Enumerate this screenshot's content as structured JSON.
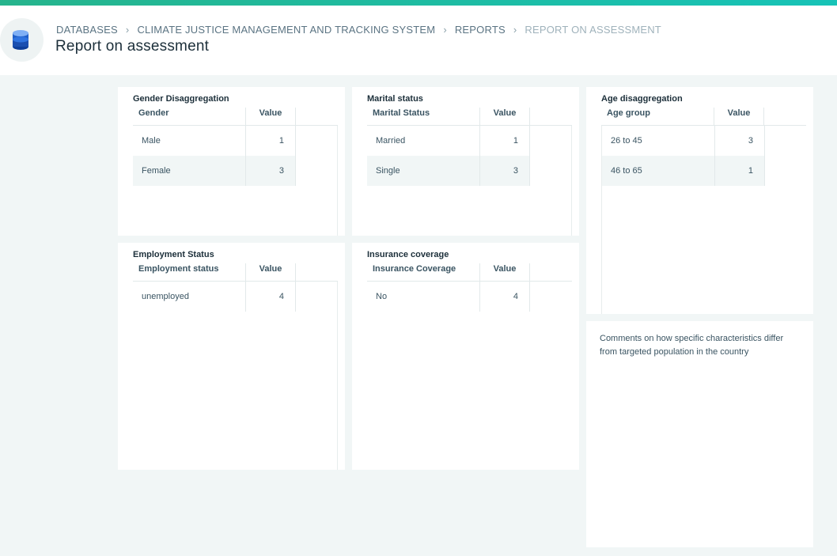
{
  "breadcrumb": {
    "items": [
      "DATABASES",
      "CLIMATE JUSTICE MANAGEMENT AND TRACKING SYSTEM",
      "REPORTS"
    ],
    "current": "REPORT ON ASSESSMENT",
    "separator": "›"
  },
  "page": {
    "title": "Report on assessment"
  },
  "icons": {
    "database": "database-icon"
  },
  "colors": {
    "accent_start": "#26b48c",
    "accent_end": "#17c3b7",
    "database_icon": "#1f5fc9"
  },
  "cards": {
    "gender": {
      "title": "Gender Disaggregation",
      "columns": [
        "Gender",
        "Value"
      ],
      "rows": [
        {
          "label": "Male",
          "value": "1"
        },
        {
          "label": "Female",
          "value": "3"
        }
      ]
    },
    "marital": {
      "title": "Marital status",
      "columns": [
        "Marital Status",
        "Value"
      ],
      "rows": [
        {
          "label": "Married",
          "value": "1"
        },
        {
          "label": "Single",
          "value": "3"
        }
      ]
    },
    "age": {
      "title": "Age disaggregation",
      "columns": [
        "Age group",
        "Value"
      ],
      "rows": [
        {
          "label": "26 to 45",
          "value": "3"
        },
        {
          "label": "46 to 65",
          "value": "1"
        }
      ]
    },
    "employment": {
      "title": "Employment Status",
      "columns": [
        "Employment status",
        "Value"
      ],
      "rows": [
        {
          "label": "unemployed",
          "value": "4"
        }
      ]
    },
    "insurance": {
      "title": "Insurance coverage",
      "columns": [
        "Insurance Coverage",
        "Value"
      ],
      "rows": [
        {
          "label": "No",
          "value": "4"
        }
      ]
    },
    "comments": {
      "text": "Comments on how specific characteristics differ from targeted population in the country"
    }
  }
}
